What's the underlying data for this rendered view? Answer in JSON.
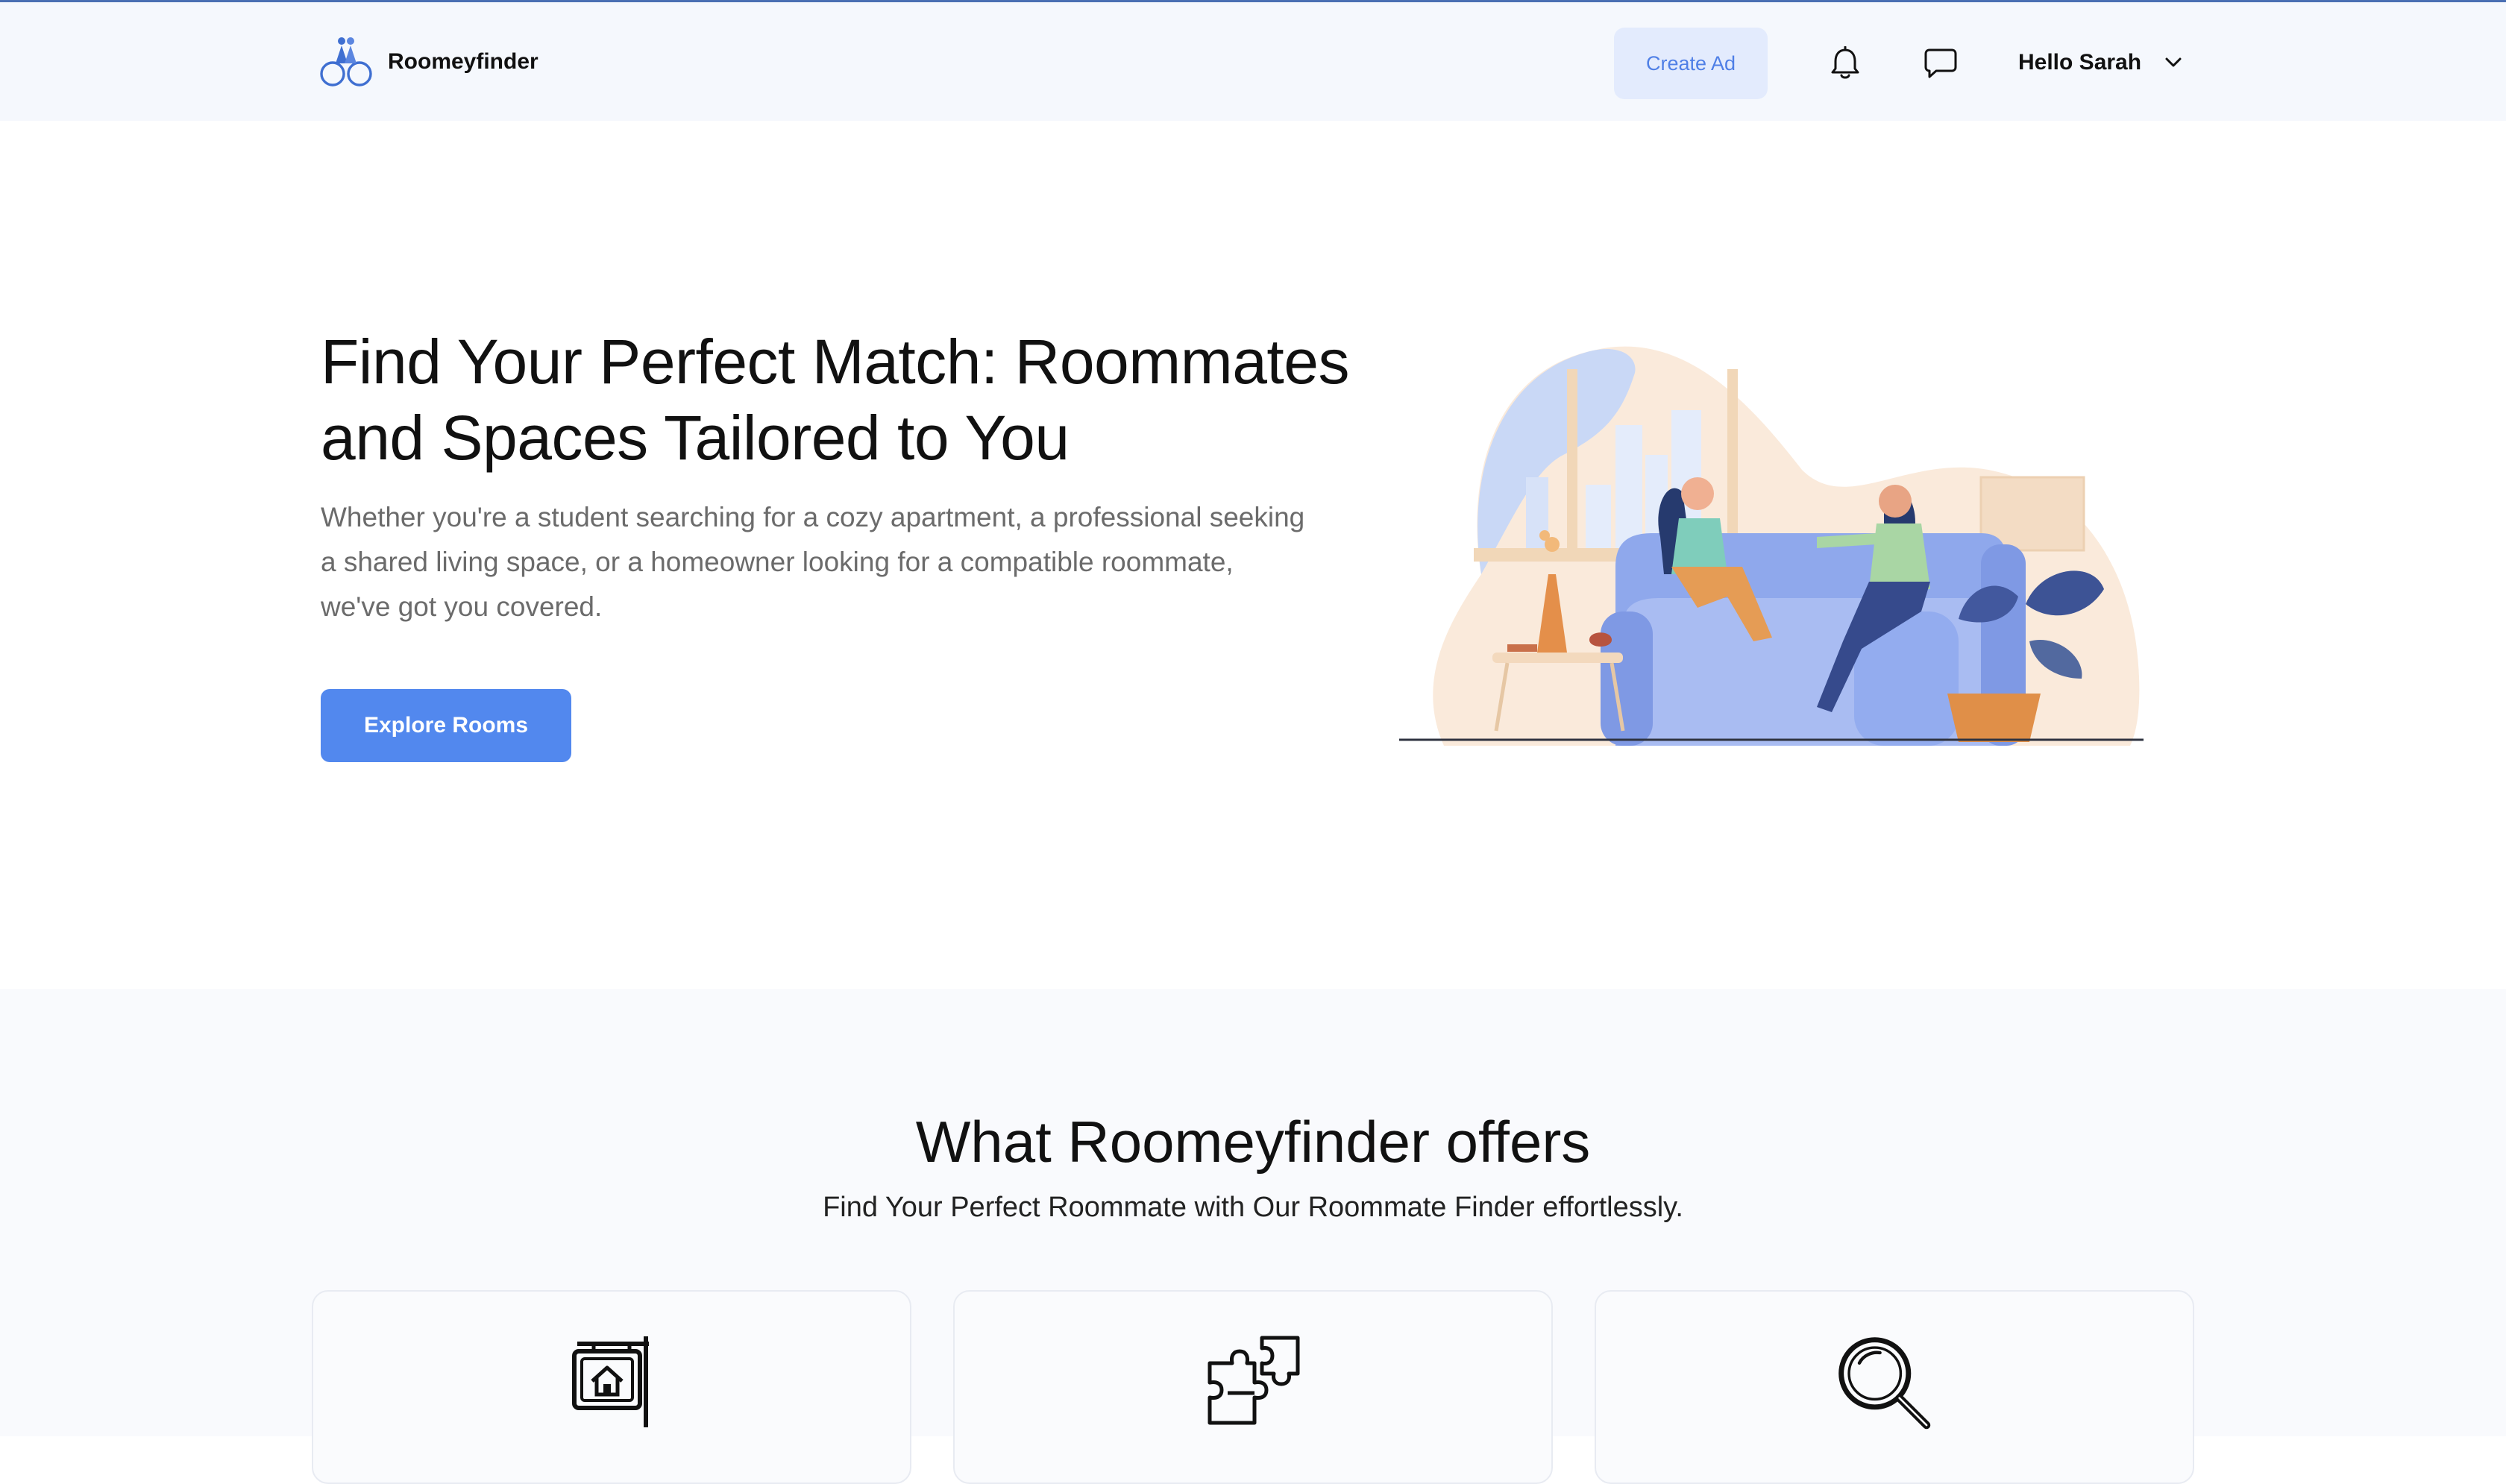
{
  "header": {
    "brand": "Roomeyfinder",
    "create_ad_label": "Create Ad",
    "greeting": "Hello Sarah",
    "icons": [
      "logo-icon",
      "bell-icon",
      "chat-icon",
      "chevron-down-icon"
    ]
  },
  "hero": {
    "title": "Find Your Perfect Match: Roommates and Spaces Tailored to You",
    "subtitle": "Whether you're a student searching for a cozy apartment, a professional seeking a shared living space, or a homeowner looking for a compatible roommate, we've got you covered.",
    "cta_label": "Explore Rooms",
    "illustration": "two-women-on-sofa-illustration"
  },
  "offers": {
    "title": "What Roomeyfinder offers",
    "subtitle": "Find Your Perfect Roommate with Our Roommate Finder effortlessly.",
    "cards": [
      {
        "icon": "house-sign-icon"
      },
      {
        "icon": "puzzle-icon"
      },
      {
        "icon": "magnifier-icon"
      }
    ]
  },
  "colors": {
    "accent": "#5288ee",
    "header_bg": "#f5f8fd",
    "create_ad_bg": "#e3ebfd",
    "create_ad_text": "#4f7fe6",
    "body_text": "#6b6b6b"
  }
}
